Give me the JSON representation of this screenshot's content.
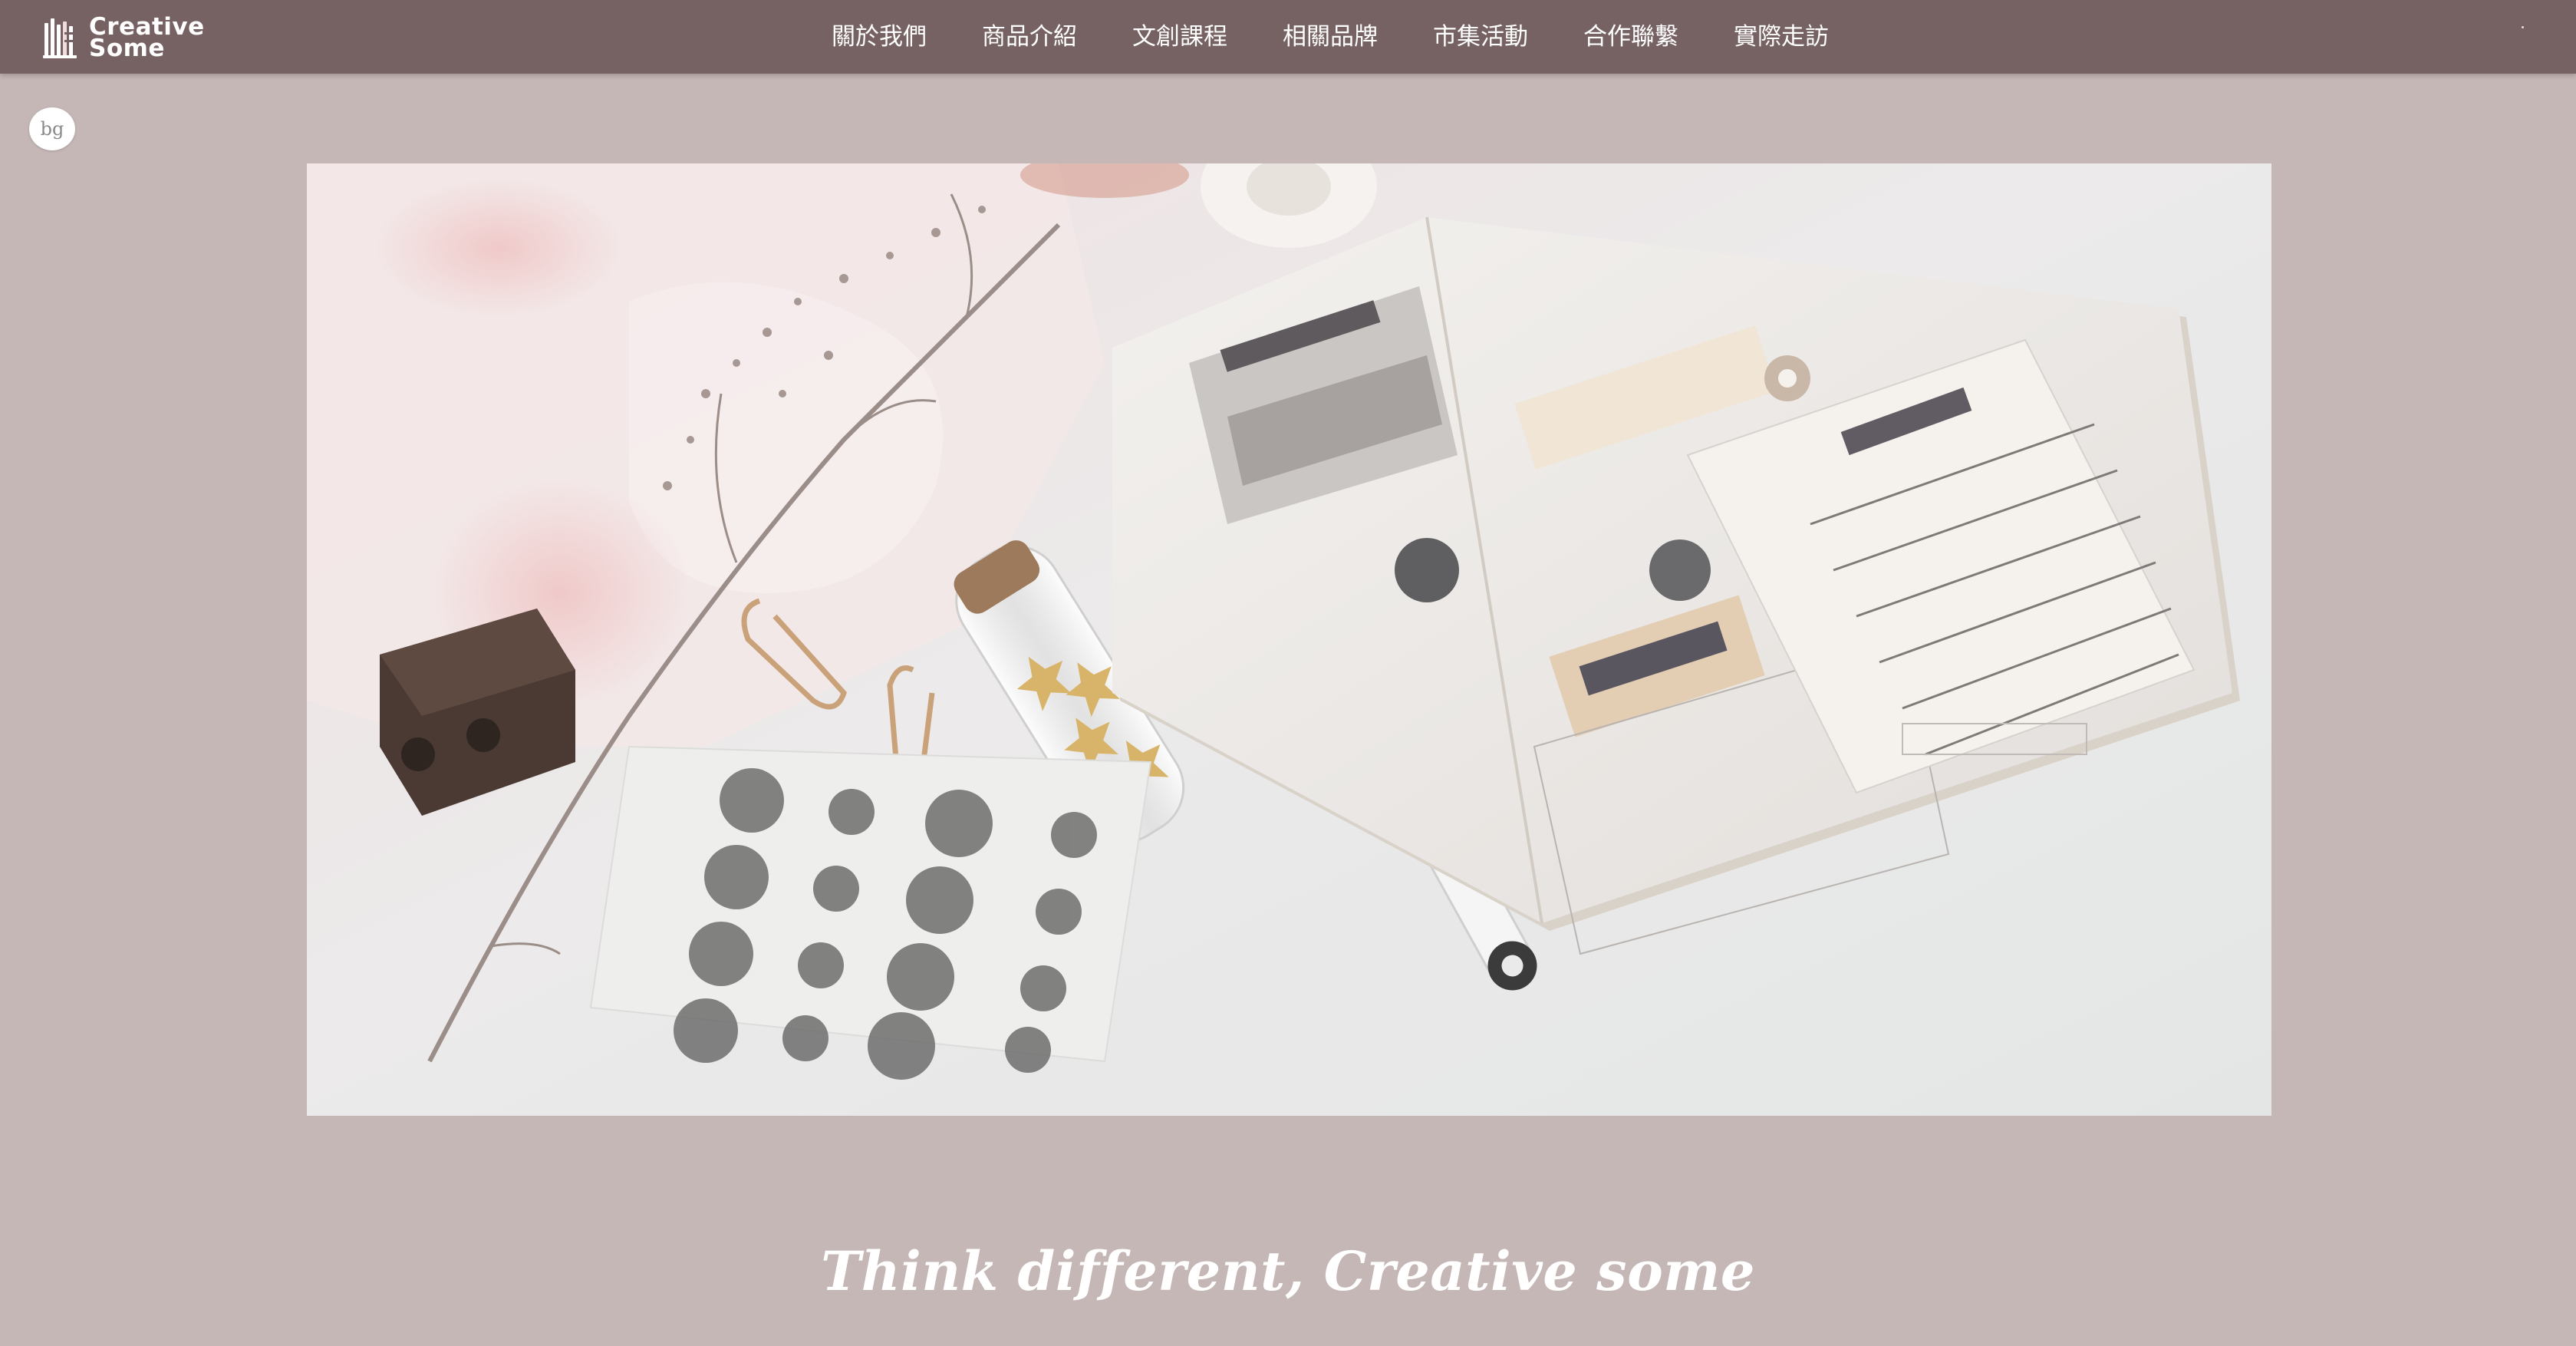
{
  "brand": {
    "name_line1": "Creative",
    "name_line2": "Some"
  },
  "nav": {
    "items": [
      {
        "label": "關於我們"
      },
      {
        "label": "商品介紹"
      },
      {
        "label": "文創課程"
      },
      {
        "label": "相關品牌"
      },
      {
        "label": "市集活動"
      },
      {
        "label": "合作聯繫"
      },
      {
        "label": "實際走訪"
      }
    ]
  },
  "badge": {
    "label": "bg"
  },
  "hero": {
    "image_icon": "stationery-flatlay-photo"
  },
  "tagline": {
    "text": "Think different, Creative some"
  },
  "colors": {
    "nav_background": "#766262",
    "page_background": "#c5b7b5",
    "text_on_dark": "#ffffff"
  }
}
